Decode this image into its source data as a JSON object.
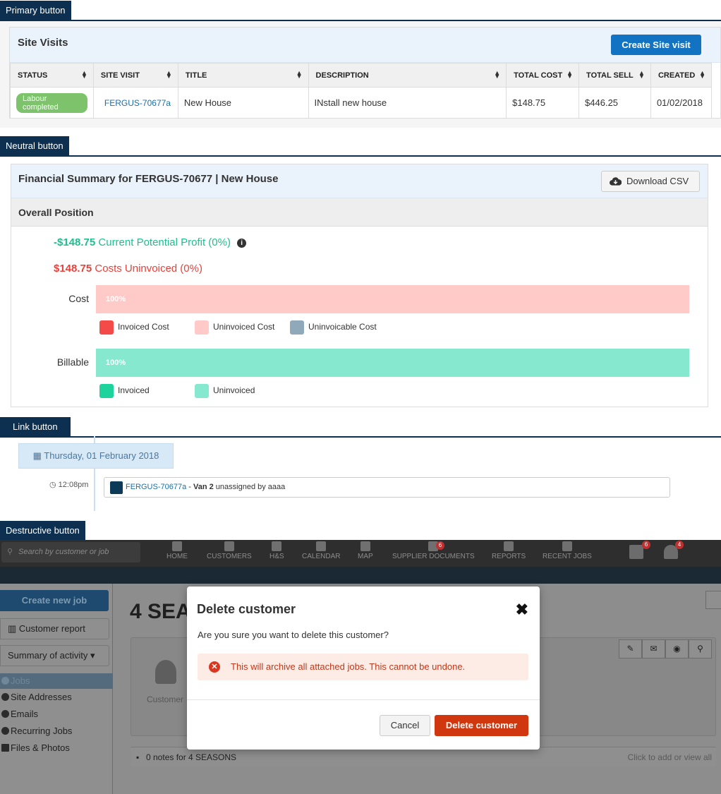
{
  "sections": {
    "primary": "Primary button",
    "neutral": "Neutral button",
    "link": "Link button",
    "destructive": "Destructive button"
  },
  "site_visits": {
    "title": "Site Visits",
    "create_label": "Create Site visit",
    "columns": [
      "STATUS",
      "SITE VISIT",
      "TITLE",
      "DESCRIPTION",
      "TOTAL COST",
      "TOTAL SELL",
      "CREATED"
    ],
    "row": {
      "status": "Labour completed",
      "site_visit": "FERGUS-70677a",
      "title": "New House",
      "description": "INstall new house",
      "total_cost": "$148.75",
      "total_sell": "$446.25",
      "created": "01/02/2018"
    }
  },
  "financial": {
    "title": "Financial Summary for FERGUS-70677 | New House",
    "download_label": "Download CSV",
    "overall_label": "Overall Position",
    "profit_value": "-$148.75",
    "profit_text": "Current Potential Profit (0%)",
    "uninvoiced_value": "$148.75",
    "uninvoiced_text": "Costs Uninvoiced (0%)",
    "cost_label": "Cost",
    "cost_bar": {
      "text": "100%",
      "fraction": 1.0
    },
    "cost_legend": [
      "Invoiced Cost",
      "Uninvoiced Cost",
      "Uninvoicable Cost"
    ],
    "billable_label": "Billable",
    "billable_bar": {
      "text": "100%",
      "fraction": 1.0
    },
    "billable_legend": [
      "Invoiced",
      "Uninvoiced"
    ],
    "colors": {
      "invoiced_cost": "#f44b48",
      "uninvoiced_cost": "#ffcac8",
      "uninvoicable_cost": "#8fa9ba",
      "invoiced": "#1fd39c",
      "uninvoiced": "#86e9cf"
    }
  },
  "timeline": {
    "date": "Thursday, 01 February 2018",
    "time": "12:08pm",
    "event_link": "FERGUS-70677a",
    "event_sep": " - ",
    "event_bold": "Van 2",
    "event_rest": " unassigned by aaaa"
  },
  "app": {
    "search_placeholder": "Search by customer or job",
    "nav": [
      {
        "label": "HOME",
        "icon": "home-icon"
      },
      {
        "label": "CUSTOMERS",
        "icon": "user-icon"
      },
      {
        "label": "H&S",
        "icon": "medkit-icon"
      },
      {
        "label": "CALENDAR",
        "icon": "calendar-icon"
      },
      {
        "label": "MAP",
        "icon": "map-marker-icon"
      },
      {
        "label": "SUPPLIER DOCUMENTS",
        "icon": "file-icon",
        "badge": "6"
      },
      {
        "label": "REPORTS",
        "icon": "bar-chart-icon"
      },
      {
        "label": "RECENT JOBS",
        "icon": "list-icon"
      }
    ],
    "tasks_badge": "6",
    "alerts_badge": "4",
    "create_job": "Create new job",
    "customer_report": "Customer report",
    "summary_activity": "Summary of activity",
    "side_links": [
      "Jobs",
      "Site Addresses",
      "Emails",
      "Recurring Jobs",
      "Files & Photos"
    ],
    "customer_title": "4 SEA",
    "customer_label": "Customer",
    "notes": "0 notes for 4 SEASONS",
    "notes_right": "Click to add or view all"
  },
  "modal": {
    "title": "Delete customer",
    "close": "✖",
    "message": "Are you sure you want to delete this customer?",
    "warning": "This will archive all attached jobs. This cannot be undone.",
    "cancel": "Cancel",
    "confirm": "Delete customer"
  }
}
